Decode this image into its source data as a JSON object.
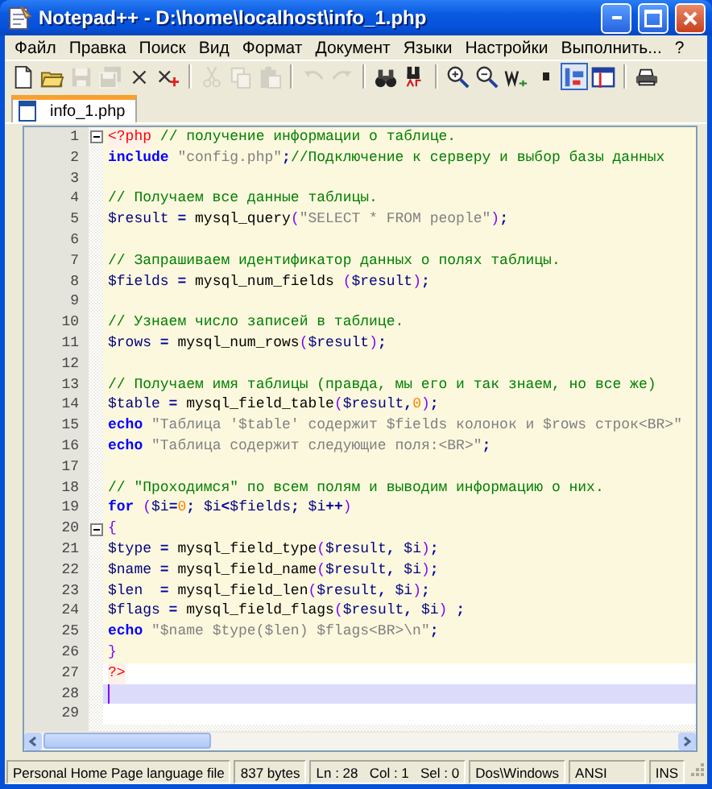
{
  "window": {
    "title": "Notepad++ - D:\\home\\localhost\\info_1.php"
  },
  "menu": [
    "Файл",
    "Правка",
    "Поиск",
    "Вид",
    "Формат",
    "Документ",
    "Языки",
    "Настройки",
    "Выполнить...",
    "?"
  ],
  "toolbar": [
    {
      "kind": "new",
      "disabled": false
    },
    {
      "kind": "open",
      "disabled": false
    },
    {
      "kind": "save",
      "disabled": true
    },
    {
      "kind": "saveall",
      "disabled": true
    },
    {
      "kind": "close",
      "disabled": false
    },
    {
      "kind": "closeall",
      "disabled": false
    },
    {
      "kind": "sep"
    },
    {
      "kind": "cut",
      "disabled": true
    },
    {
      "kind": "copy",
      "disabled": true
    },
    {
      "kind": "paste",
      "disabled": true
    },
    {
      "kind": "sep"
    },
    {
      "kind": "undo",
      "disabled": true
    },
    {
      "kind": "redo",
      "disabled": true
    },
    {
      "kind": "sep"
    },
    {
      "kind": "find",
      "disabled": false
    },
    {
      "kind": "replace",
      "disabled": false
    },
    {
      "kind": "sep"
    },
    {
      "kind": "zoomin",
      "disabled": false
    },
    {
      "kind": "zoomout",
      "disabled": false
    },
    {
      "kind": "wrap",
      "disabled": false
    },
    {
      "kind": "dot",
      "disabled": false
    },
    {
      "kind": "guides",
      "disabled": false,
      "on": true
    },
    {
      "kind": "sync",
      "disabled": false
    },
    {
      "kind": "sep"
    },
    {
      "kind": "print",
      "disabled": false
    }
  ],
  "tabs": [
    {
      "label": "info_1.php",
      "selected": true
    }
  ],
  "editor": {
    "lines": [
      {
        "number": "1",
        "fold": true,
        "php": true,
        "current": false,
        "tokens": [
          {
            "kind": "tag",
            "text": "<?php"
          },
          {
            "kind": "cmt",
            "text": " // получение информации о таблице."
          }
        ]
      },
      {
        "number": "2",
        "fold": false,
        "php": true,
        "current": false,
        "tokens": [
          {
            "kind": "kw",
            "text": "include"
          },
          {
            "kind": "str",
            "text": " \"config.php\""
          },
          {
            "kind": "op",
            "text": ";"
          },
          {
            "kind": "cmt",
            "text": "//Подключение к серверу и выбор базы данных"
          }
        ]
      },
      {
        "number": "3",
        "fold": false,
        "php": true,
        "current": false
      },
      {
        "number": "4",
        "fold": false,
        "php": true,
        "current": false,
        "tokens": [
          {
            "kind": "cmt",
            "text": "// Получаем все данные таблицы."
          }
        ]
      },
      {
        "number": "5",
        "fold": false,
        "php": true,
        "current": false,
        "tokens": [
          {
            "kind": "var",
            "text": "$result"
          },
          {
            "kind": "op",
            "text": " = "
          },
          {
            "kind": "fn",
            "text": "mysql_query"
          },
          {
            "kind": "paren",
            "text": "("
          },
          {
            "kind": "str",
            "text": "\"SELECT * FROM people\""
          },
          {
            "kind": "paren",
            "text": ")"
          },
          {
            "kind": "op",
            "text": ";"
          }
        ]
      },
      {
        "number": "6",
        "fold": false,
        "php": true,
        "current": false
      },
      {
        "number": "7",
        "fold": false,
        "php": true,
        "current": false,
        "tokens": [
          {
            "kind": "cmt",
            "text": "// Запрашиваем идентификатор данных о полях таблицы."
          }
        ]
      },
      {
        "number": "8",
        "fold": false,
        "php": true,
        "current": false,
        "tokens": [
          {
            "kind": "var",
            "text": "$fields"
          },
          {
            "kind": "op",
            "text": " = "
          },
          {
            "kind": "fn",
            "text": "mysql_num_fields "
          },
          {
            "kind": "paren",
            "text": "("
          },
          {
            "kind": "var",
            "text": "$result"
          },
          {
            "kind": "paren",
            "text": ")"
          },
          {
            "kind": "op",
            "text": ";"
          }
        ]
      },
      {
        "number": "9",
        "fold": false,
        "php": true,
        "current": false
      },
      {
        "number": "10",
        "fold": false,
        "php": true,
        "current": false,
        "tokens": [
          {
            "kind": "cmt",
            "text": "// Узнаем число записей в таблице."
          }
        ]
      },
      {
        "number": "11",
        "fold": false,
        "php": true,
        "current": false,
        "tokens": [
          {
            "kind": "var",
            "text": "$rows"
          },
          {
            "kind": "op",
            "text": " = "
          },
          {
            "kind": "fn",
            "text": "mysql_num_rows"
          },
          {
            "kind": "paren",
            "text": "("
          },
          {
            "kind": "var",
            "text": "$result"
          },
          {
            "kind": "paren",
            "text": ")"
          },
          {
            "kind": "op",
            "text": ";"
          }
        ]
      },
      {
        "number": "12",
        "fold": false,
        "php": true,
        "current": false
      },
      {
        "number": "13",
        "fold": false,
        "php": true,
        "current": false,
        "tokens": [
          {
            "kind": "cmt",
            "text": "// Получаем имя таблицы (правда, мы его и так знаем, но все же)"
          }
        ]
      },
      {
        "number": "14",
        "fold": false,
        "php": true,
        "current": false,
        "tokens": [
          {
            "kind": "var",
            "text": "$table"
          },
          {
            "kind": "op",
            "text": " = "
          },
          {
            "kind": "fn",
            "text": "mysql_field_table"
          },
          {
            "kind": "paren",
            "text": "("
          },
          {
            "kind": "var",
            "text": "$result"
          },
          {
            "kind": "op",
            "text": ","
          },
          {
            "kind": "num",
            "text": "0"
          },
          {
            "kind": "paren",
            "text": ")"
          },
          {
            "kind": "op",
            "text": ";"
          }
        ]
      },
      {
        "number": "15",
        "fold": false,
        "php": true,
        "current": false,
        "tokens": [
          {
            "kind": "kw",
            "text": "echo"
          },
          {
            "kind": "str",
            "text": " \"Таблица '$table' содержит $fields колонок и $rows строк<BR>\""
          }
        ]
      },
      {
        "number": "16",
        "fold": false,
        "php": true,
        "current": false,
        "tokens": [
          {
            "kind": "kw",
            "text": "echo"
          },
          {
            "kind": "str",
            "text": " \"Таблица содержит следующие поля:<BR>\""
          },
          {
            "kind": "op",
            "text": ";"
          }
        ]
      },
      {
        "number": "17",
        "fold": false,
        "php": true,
        "current": false
      },
      {
        "number": "18",
        "fold": false,
        "php": true,
        "current": false,
        "tokens": [
          {
            "kind": "cmt",
            "text": "// \"Проходимся\" по всем полям и выводим информацию о них."
          }
        ]
      },
      {
        "number": "19",
        "fold": false,
        "php": true,
        "current": false,
        "tokens": [
          {
            "kind": "kw",
            "text": "for"
          },
          {
            "kind": "paren",
            "text": " ("
          },
          {
            "kind": "var",
            "text": "$i"
          },
          {
            "kind": "op",
            "text": "="
          },
          {
            "kind": "num",
            "text": "0"
          },
          {
            "kind": "op",
            "text": "; "
          },
          {
            "kind": "var",
            "text": "$i"
          },
          {
            "kind": "op",
            "text": "<"
          },
          {
            "kind": "var",
            "text": "$fields"
          },
          {
            "kind": "op",
            "text": "; "
          },
          {
            "kind": "var",
            "text": "$i"
          },
          {
            "kind": "op",
            "text": "++"
          },
          {
            "kind": "paren",
            "text": ")"
          }
        ]
      },
      {
        "number": "20",
        "fold": true,
        "php": true,
        "current": false,
        "tokens": [
          {
            "kind": "paren",
            "text": "{"
          }
        ]
      },
      {
        "number": "21",
        "fold": false,
        "php": true,
        "current": false,
        "tokens": [
          {
            "kind": "var",
            "text": "$type"
          },
          {
            "kind": "op",
            "text": " = "
          },
          {
            "kind": "fn",
            "text": "mysql_field_type"
          },
          {
            "kind": "paren",
            "text": "("
          },
          {
            "kind": "var",
            "text": "$result"
          },
          {
            "kind": "op",
            "text": ", "
          },
          {
            "kind": "var",
            "text": "$i"
          },
          {
            "kind": "paren",
            "text": ")"
          },
          {
            "kind": "op",
            "text": ";"
          }
        ]
      },
      {
        "number": "22",
        "fold": false,
        "php": true,
        "current": false,
        "tokens": [
          {
            "kind": "var",
            "text": "$name"
          },
          {
            "kind": "op",
            "text": " = "
          },
          {
            "kind": "fn",
            "text": "mysql_field_name"
          },
          {
            "kind": "paren",
            "text": "("
          },
          {
            "kind": "var",
            "text": "$result"
          },
          {
            "kind": "op",
            "text": ", "
          },
          {
            "kind": "var",
            "text": "$i"
          },
          {
            "kind": "paren",
            "text": ")"
          },
          {
            "kind": "op",
            "text": ";"
          }
        ]
      },
      {
        "number": "23",
        "fold": false,
        "php": true,
        "current": false,
        "tokens": [
          {
            "kind": "var",
            "text": "$len"
          },
          {
            "kind": "op",
            "text": "  = "
          },
          {
            "kind": "fn",
            "text": "mysql_field_len"
          },
          {
            "kind": "paren",
            "text": "("
          },
          {
            "kind": "var",
            "text": "$result"
          },
          {
            "kind": "op",
            "text": ", "
          },
          {
            "kind": "var",
            "text": "$i"
          },
          {
            "kind": "paren",
            "text": ")"
          },
          {
            "kind": "op",
            "text": ";"
          }
        ]
      },
      {
        "number": "24",
        "fold": false,
        "php": true,
        "current": false,
        "tokens": [
          {
            "kind": "var",
            "text": "$flags"
          },
          {
            "kind": "op",
            "text": " = "
          },
          {
            "kind": "fn",
            "text": "mysql_field_flags"
          },
          {
            "kind": "paren",
            "text": "("
          },
          {
            "kind": "var",
            "text": "$result"
          },
          {
            "kind": "op",
            "text": ", "
          },
          {
            "kind": "var",
            "text": "$i"
          },
          {
            "kind": "paren",
            "text": ")"
          },
          {
            "kind": "op",
            "text": " ;"
          }
        ]
      },
      {
        "number": "25",
        "fold": false,
        "php": true,
        "current": false,
        "tokens": [
          {
            "kind": "kw",
            "text": "echo"
          },
          {
            "kind": "str",
            "text": " \"$name $type($len) $flags<BR>\\n\""
          },
          {
            "kind": "op",
            "text": ";"
          }
        ]
      },
      {
        "number": "26",
        "fold": false,
        "php": true,
        "current": false,
        "tokens": [
          {
            "kind": "paren",
            "text": "}"
          }
        ]
      },
      {
        "number": "27",
        "fold": false,
        "php": false,
        "current": false,
        "tokens": [
          {
            "kind": "tag",
            "text": "?>"
          }
        ]
      },
      {
        "number": "28",
        "fold": false,
        "php": false,
        "current": true
      },
      {
        "number": "29",
        "fold": false,
        "php": false,
        "current": false
      }
    ]
  },
  "status_bar": [
    "Personal Home Page language file",
    "837 bytes",
    "Ln : 28   Col : 1   Sel : 0",
    "Dos\\Windows",
    "ANSI",
    "INS"
  ]
}
